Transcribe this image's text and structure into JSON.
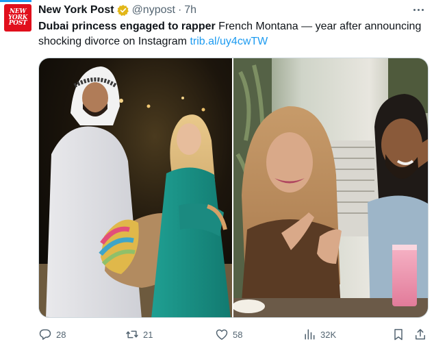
{
  "colors": {
    "accent": "#1d9bf0",
    "brand_red": "#e10f1c",
    "secondary_text": "#536471"
  },
  "author": {
    "avatar_lines": [
      "NEW",
      "YORK",
      "POST"
    ],
    "name": "New York Post",
    "verified": "verified-badge-gold-icon",
    "handle": "@nypost",
    "separator": "·",
    "time": "7h"
  },
  "tweet": {
    "headline": "Dubai princess engaged to rapper",
    "body": " French Montana — year after announcing shocking divorce on Instagram ",
    "link": "trib.al/uy4cwTW"
  },
  "media": [
    {
      "icon": "photo-camel-desert-night"
    },
    {
      "icon": "photo-restaurant-selfie"
    }
  ],
  "actions": {
    "reply": {
      "icon": "reply-icon",
      "count": "28"
    },
    "retweet": {
      "icon": "retweet-icon",
      "count": "21"
    },
    "like": {
      "icon": "heart-icon",
      "count": "58"
    },
    "views": {
      "icon": "analytics-icon",
      "count": "32K"
    },
    "bookmark": {
      "icon": "bookmark-icon"
    },
    "share": {
      "icon": "share-icon"
    }
  }
}
